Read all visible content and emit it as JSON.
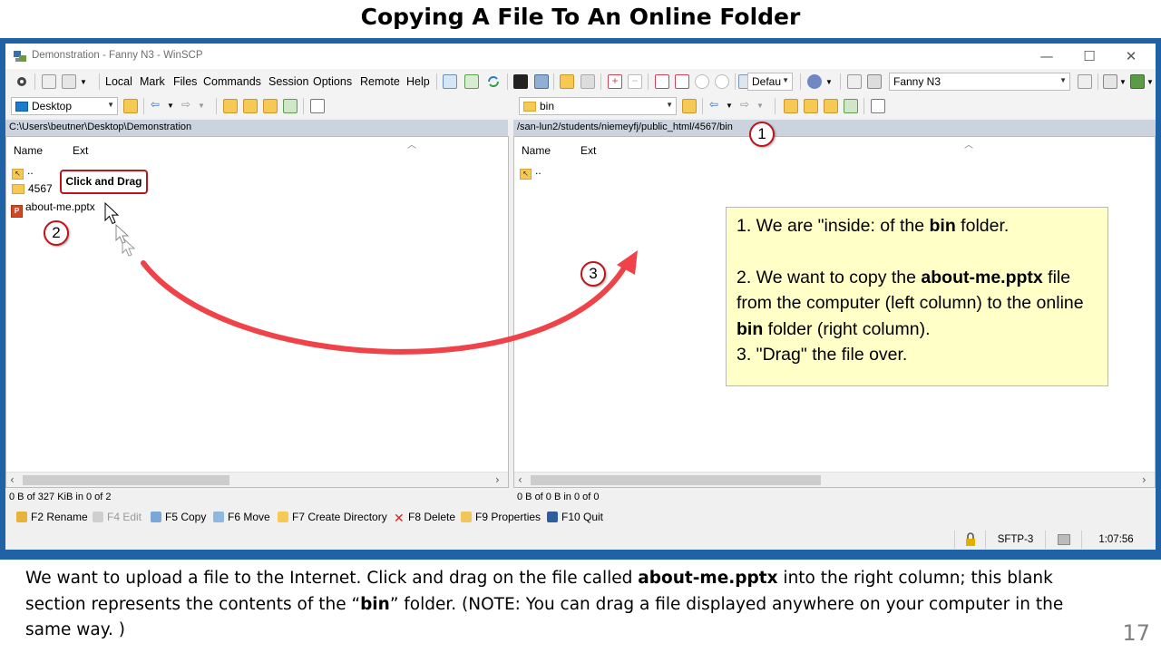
{
  "slide": {
    "title": "Copying A File To An Online Folder",
    "page_number": "17",
    "caption": {
      "p1": "We want to upload a file to the Internet. Click and drag on the file called ",
      "b1": "about-me.pptx",
      "p2": " into the right column; this blank section represents the contents of the “",
      "b2": "bin",
      "p3": "” folder.  (NOTE: You can drag a file displayed anywhere on your computer in the same way. )"
    }
  },
  "window": {
    "title": "Demonstration - Fanny N3 - WinSCP",
    "controls": {
      "minimize": "—",
      "maximize": "☐",
      "close": "✕"
    }
  },
  "menu": [
    "Local",
    "Mark",
    "Files",
    "Commands",
    "Session",
    "Options",
    "Remote",
    "Help"
  ],
  "toolbar": {
    "transfer_settings": "Defau",
    "session_name": "Fanny N3"
  },
  "left_panel": {
    "location": "Desktop",
    "path": "C:\\Users\\beutner\\Desktop\\Demonstration",
    "columns": [
      "Name",
      "Ext"
    ],
    "files": [
      "..",
      "4567",
      "about-me.pptx"
    ],
    "status": "0 B of 327 KiB in 0 of 2"
  },
  "right_panel": {
    "location": "bin",
    "path": "/san-lun2/students/niemeyfj/public_html/4567/bin",
    "columns": [
      "Name",
      "Ext"
    ],
    "files": [
      ".."
    ],
    "status": "0 B of 0 B in 0 of 0"
  },
  "function_keys": [
    {
      "label": "F2 Rename",
      "enabled": true
    },
    {
      "label": "F4 Edit",
      "enabled": false
    },
    {
      "label": "F5 Copy",
      "enabled": true
    },
    {
      "label": "F6 Move",
      "enabled": true
    },
    {
      "label": "F7 Create Directory",
      "enabled": true
    },
    {
      "label": "F8 Delete",
      "enabled": true
    },
    {
      "label": "F9 Properties",
      "enabled": true
    },
    {
      "label": "F10 Quit",
      "enabled": true
    }
  ],
  "statusbar": {
    "protocol": "SFTP-3",
    "time": "1:07:56"
  },
  "annotations": {
    "callout": "Click and Drag",
    "badges": [
      "1",
      "2",
      "3"
    ],
    "note": {
      "l1a": "1. We are \"inside: of the ",
      "l1b": "bin",
      "l1c": " folder.",
      "l2a": "2. We want to copy the ",
      "l2b": "about-me.pptx",
      "l2c": " file from the computer (left column) to the online ",
      "l2d": "bin",
      "l2e": " folder (right column).",
      "l3": "3. \"Drag\" the file over."
    }
  },
  "colors": {
    "window_frame": "#1f63a6",
    "path_bar": "#cad3de",
    "annotation_red": "#c0141c",
    "arrow_red": "#ef4349",
    "note_background": "#ffffc8"
  }
}
